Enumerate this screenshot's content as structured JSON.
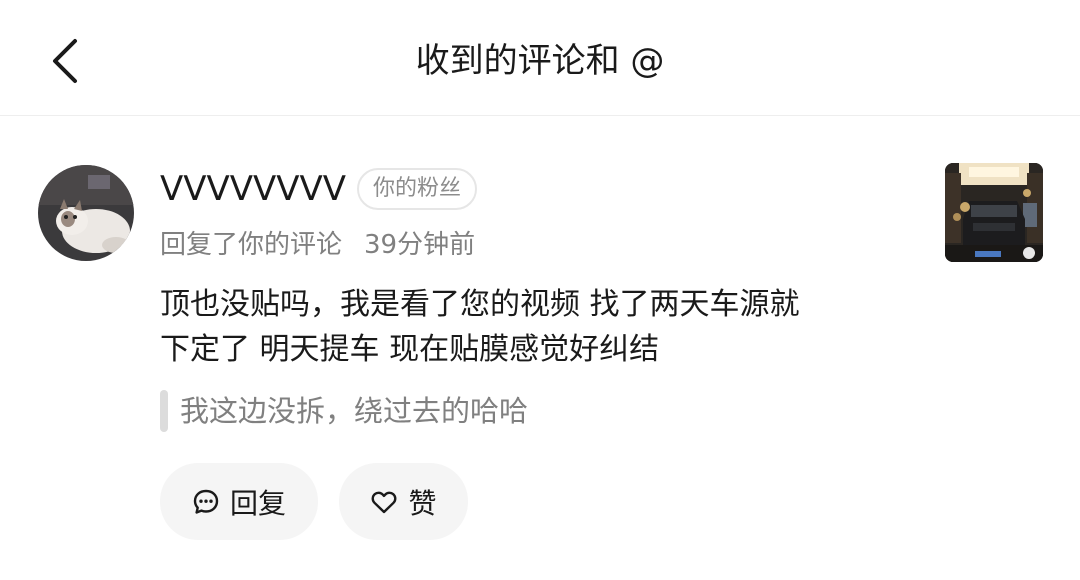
{
  "header": {
    "back_icon": "chevron-left-icon",
    "title": "收到的评论和 @"
  },
  "comment": {
    "username": "VVVVVVVV",
    "badge": "你的粉丝",
    "action": "回复了你的评论",
    "time": "39分钟前",
    "text_line1": "顶也没贴吗，我是看了您的视频 找了两天车源就",
    "text_line2": "下定了 明天提车 现在贴膜感觉好纠结",
    "quoted": "我这边没拆，绕过去的哈哈"
  },
  "actions": {
    "reply_label": "回复",
    "like_label": "赞",
    "reply_icon": "comment-bubble-icon",
    "like_icon": "heart-icon"
  },
  "colors": {
    "text_primary": "#1a1a1a",
    "text_secondary": "#808080",
    "button_bg": "#f5f5f5",
    "badge_border": "#e6e6e6"
  }
}
